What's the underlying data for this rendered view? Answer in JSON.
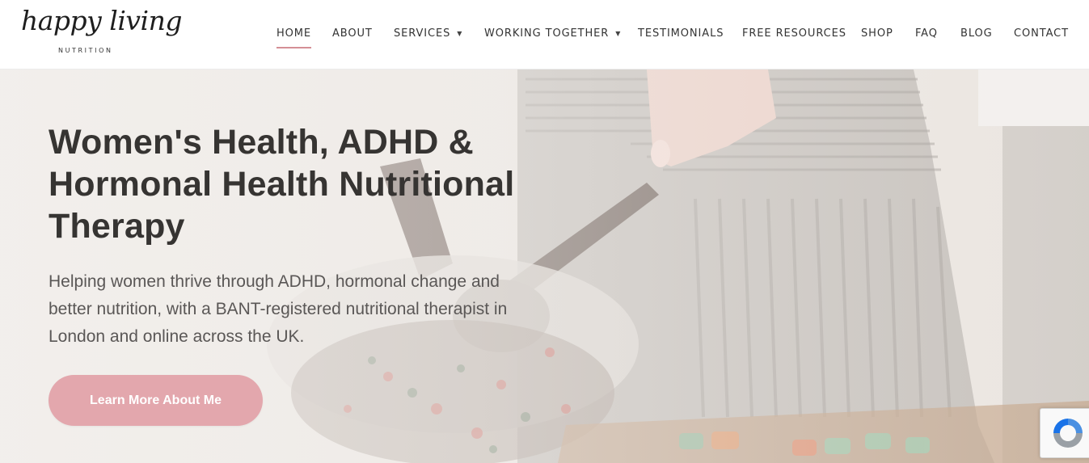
{
  "logo": {
    "script_text": "happy living",
    "sub_text": "NUTRITION"
  },
  "nav": {
    "items": [
      {
        "label": "HOME",
        "active": true,
        "has_dropdown": false
      },
      {
        "label": "ABOUT",
        "active": false,
        "has_dropdown": false
      },
      {
        "label": "SERVICES",
        "active": false,
        "has_dropdown": true
      },
      {
        "label": "WORKING TOGETHER",
        "active": false,
        "has_dropdown": true
      },
      {
        "label": "TESTIMONIALS",
        "active": false,
        "has_dropdown": false
      },
      {
        "label": "FREE RESOURCES",
        "active": false,
        "has_dropdown": false
      },
      {
        "label": "SHOP",
        "active": false,
        "has_dropdown": false
      },
      {
        "label": "FAQ",
        "active": false,
        "has_dropdown": false
      },
      {
        "label": "BLOG",
        "active": false,
        "has_dropdown": false
      },
      {
        "label": "CONTACT",
        "active": false,
        "has_dropdown": false
      }
    ],
    "caret": "▼"
  },
  "hero": {
    "title": "Women's Health, ADHD & Hormonal Health Nutritional Therapy",
    "text": "Helping women thrive through ADHD, hormonal change and better nutrition, with a BANT-registered nutritional therapist in London and online across the UK.",
    "button_label": "Learn More About Me"
  },
  "colors": {
    "accent": "#d48f96",
    "button": "#e3a7ad",
    "title": "#363432",
    "body_text": "#5a5756"
  },
  "icons": {
    "recaptcha": "recaptcha-icon"
  }
}
